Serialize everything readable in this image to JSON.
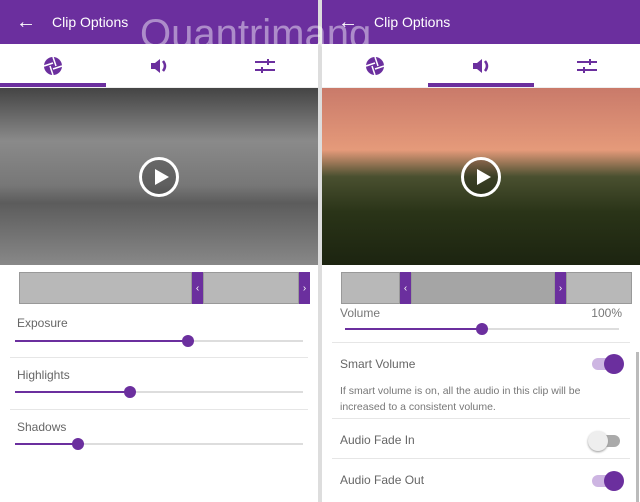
{
  "header": {
    "title": "Clip Options",
    "back": "←"
  },
  "watermark": "Quantrimang",
  "tabs": [
    {
      "icon": "aperture-icon"
    },
    {
      "icon": "speaker-icon"
    },
    {
      "icon": "sliders-icon"
    }
  ],
  "left": {
    "active_tab": 0,
    "sliders": [
      {
        "label": "Exposure",
        "value": 60
      },
      {
        "label": "Highlights",
        "value": 40
      },
      {
        "label": "Shadows",
        "value": 22
      }
    ]
  },
  "right": {
    "active_tab": 1,
    "volume": {
      "label": "Volume",
      "value_text": "100%",
      "value": 50
    },
    "smart_volume": {
      "label": "Smart Volume",
      "on": true,
      "description": "If smart volume is on, all the audio in this clip will be increased to a consistent volume."
    },
    "fade_in": {
      "label": "Audio Fade In",
      "on": false
    },
    "fade_out": {
      "label": "Audio Fade Out",
      "on": true
    }
  },
  "colors": {
    "accent": "#6b2f9e"
  }
}
